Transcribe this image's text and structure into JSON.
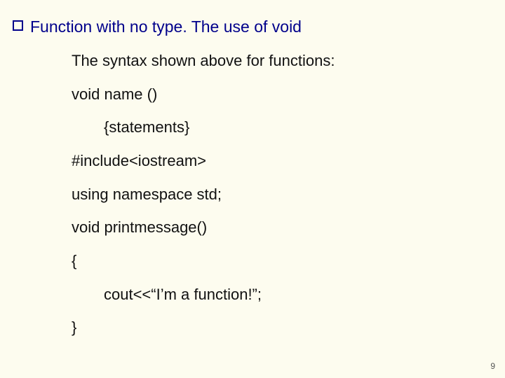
{
  "heading": "Function with no type. The use of void",
  "lines": {
    "l0": "The syntax shown above for functions:",
    "l1": "void name ()",
    "l2": "{statements}",
    "l3": "#include<iostream>",
    "l4": "using namespace std;",
    "l5": "void printmessage()",
    "l6": "{",
    "l7": "cout<<“I’m a function!”;",
    "l8": "}"
  },
  "page_number": "9"
}
